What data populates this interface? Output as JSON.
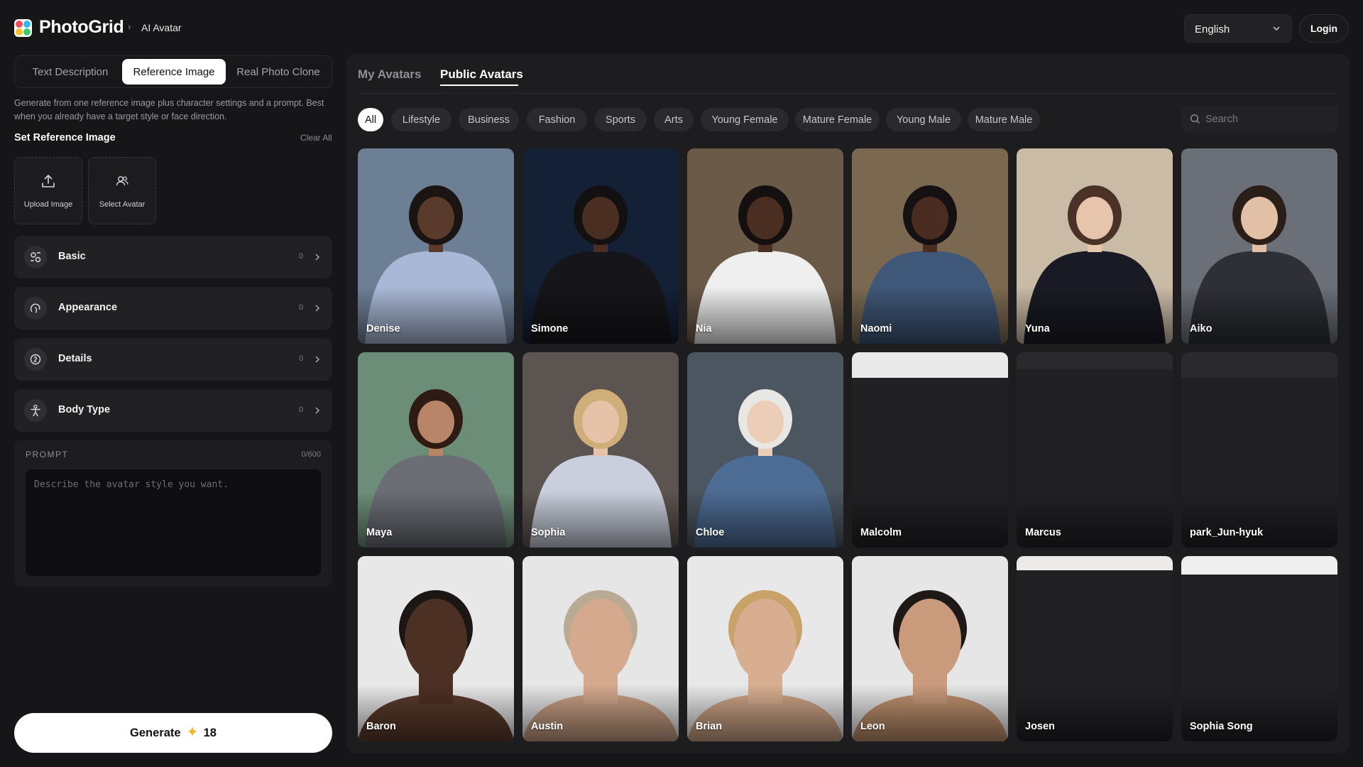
{
  "header": {
    "brand": "PhotoGrid",
    "breadcrumb_sep": "›",
    "breadcrumb": "AI Avatar",
    "language": "English",
    "login_label": "Login"
  },
  "mode_tabs": [
    {
      "label": "Text Description",
      "active": false
    },
    {
      "label": "Reference Image",
      "active": true
    },
    {
      "label": "Real Photo Clone",
      "active": false
    }
  ],
  "reference": {
    "description": "Generate from one reference image plus character settings and a prompt. Best when you already have a target style or face direction.",
    "title": "Set Reference Image",
    "clear_all": "Clear All",
    "upload_label": "Upload Image",
    "select_label": "Select Avatar"
  },
  "settings": [
    {
      "label": "Basic",
      "count": "0",
      "icon": "sliders-icon"
    },
    {
      "label": "Appearance",
      "count": "0",
      "icon": "face-icon"
    },
    {
      "label": "Details",
      "count": "0",
      "icon": "detail-icon"
    },
    {
      "label": "Body Type",
      "count": "0",
      "icon": "body-icon"
    }
  ],
  "prompt": {
    "label": "PROMPT",
    "counter": "0/600",
    "placeholder": "Describe the avatar style you want."
  },
  "generate": {
    "label": "Generate",
    "cost": "18",
    "icon": "sparkle-icon",
    "accent": "#f5b52e"
  },
  "main": {
    "tabs": [
      {
        "label": "My Avatars",
        "active": false
      },
      {
        "label": "Public Avatars",
        "active": true
      }
    ],
    "filters": [
      {
        "label": "All",
        "active": true
      },
      {
        "label": "Lifestyle",
        "active": false
      },
      {
        "label": "Business",
        "active": false
      },
      {
        "label": "Fashion",
        "active": false
      },
      {
        "label": "Sports",
        "active": false
      },
      {
        "label": "Arts",
        "active": false
      },
      {
        "label": "Young Female",
        "active": false
      },
      {
        "label": "Mature Female",
        "active": false
      },
      {
        "label": "Young Male",
        "active": false
      },
      {
        "label": "Mature Male",
        "active": false
      }
    ],
    "search_placeholder": "Search",
    "avatars": [
      {
        "name": "Denise",
        "bg": "#6d7f95",
        "skin": "#5a3a2a",
        "hair": "#1a1412",
        "cloth": "#a9b8d6",
        "loaded": true
      },
      {
        "name": "Simone",
        "bg": "#132036",
        "skin": "#4a2e22",
        "hair": "#121010",
        "cloth": "#16161a",
        "loaded": true
      },
      {
        "name": "Nia",
        "bg": "#6b5a48",
        "skin": "#4b2e22",
        "hair": "#141010",
        "cloth": "#efefef",
        "loaded": true
      },
      {
        "name": "Naomi",
        "bg": "#7a6850",
        "skin": "#4a2c20",
        "hair": "#151112",
        "cloth": "#3f5778",
        "loaded": true
      },
      {
        "name": "Yuna",
        "bg": "#c9bba6",
        "skin": "#e6c5ac",
        "hair": "#4a3226",
        "cloth": "#1a1a24",
        "loaded": true
      },
      {
        "name": "Aiko",
        "bg": "#6a6f78",
        "skin": "#e2c0a6",
        "hair": "#2a1e18",
        "cloth": "#2e3036",
        "loaded": true
      },
      {
        "name": "Maya",
        "bg": "#6c8e78",
        "skin": "#b98568",
        "hair": "#2e1c14",
        "cloth": "#6c6e76",
        "loaded": true
      },
      {
        "name": "Sophia",
        "bg": "#5c5450",
        "skin": "#e6c2a8",
        "hair": "#cfae7a",
        "cloth": "#c9cfdc",
        "loaded": true
      },
      {
        "name": "Chloe",
        "bg": "#4c5660",
        "skin": "#eccdb8",
        "hair": "#e9e7e4",
        "cloth": "#4d6c94",
        "loaded": true
      },
      {
        "name": "Malcolm",
        "bg": "#e9e9ea",
        "loaded": false,
        "stripe": 36
      },
      {
        "name": "Marcus",
        "bg": "#2a2a2d",
        "loaded": false,
        "stripe": 24
      },
      {
        "name": "park_Jun-hyuk",
        "bg": "#2a2a2d",
        "loaded": false,
        "stripe": 36
      },
      {
        "name": "Baron",
        "bg": "#e8e8e8",
        "skin": "#4d3024",
        "hair": "#1c1614",
        "cloth": "#5a3b2c",
        "loaded": true
      },
      {
        "name": "Austin",
        "bg": "#e6e6e6",
        "skin": "#d4a98e",
        "hair": "#b9aa94",
        "cloth": "#caa084",
        "loaded": true
      },
      {
        "name": "Brian",
        "bg": "#e8e8e8",
        "skin": "#d8ae90",
        "hair": "#c9a26a",
        "cloth": "#cfa587",
        "loaded": true
      },
      {
        "name": "Leon",
        "bg": "#e6e6e6",
        "skin": "#c99a7c",
        "hair": "#1e1816",
        "cloth": "#c1916f",
        "loaded": true
      },
      {
        "name": "Josen",
        "bg": "#ecebea",
        "loaded": false,
        "stripe": 20
      },
      {
        "name": "Sophia Song",
        "bg": "#efefef",
        "loaded": false,
        "stripe": 26
      }
    ]
  }
}
